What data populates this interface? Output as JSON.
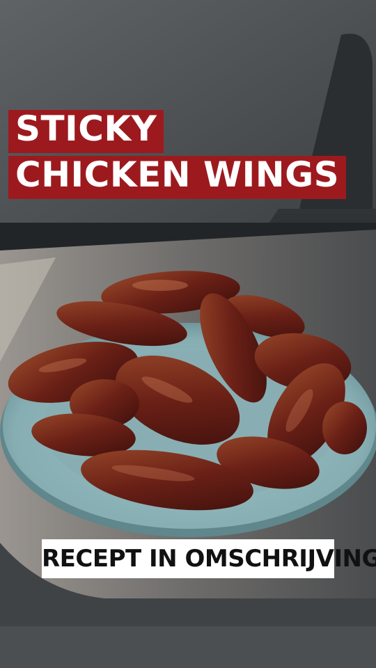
{
  "overlay": {
    "title_line_1": "STICKY",
    "title_line_2": "CHICKEN WINGS",
    "caption": "RECEPT IN OMSCHRIJVING"
  },
  "colors": {
    "title_bg": "#9c1a1e",
    "title_text": "#ffffff",
    "caption_bg": "#ffffff",
    "caption_text": "#111111",
    "plate": "#8fb3b8",
    "sauce": "#5a1a12"
  },
  "icons": [
    "grill-photo",
    "plate",
    "chicken-wings"
  ]
}
